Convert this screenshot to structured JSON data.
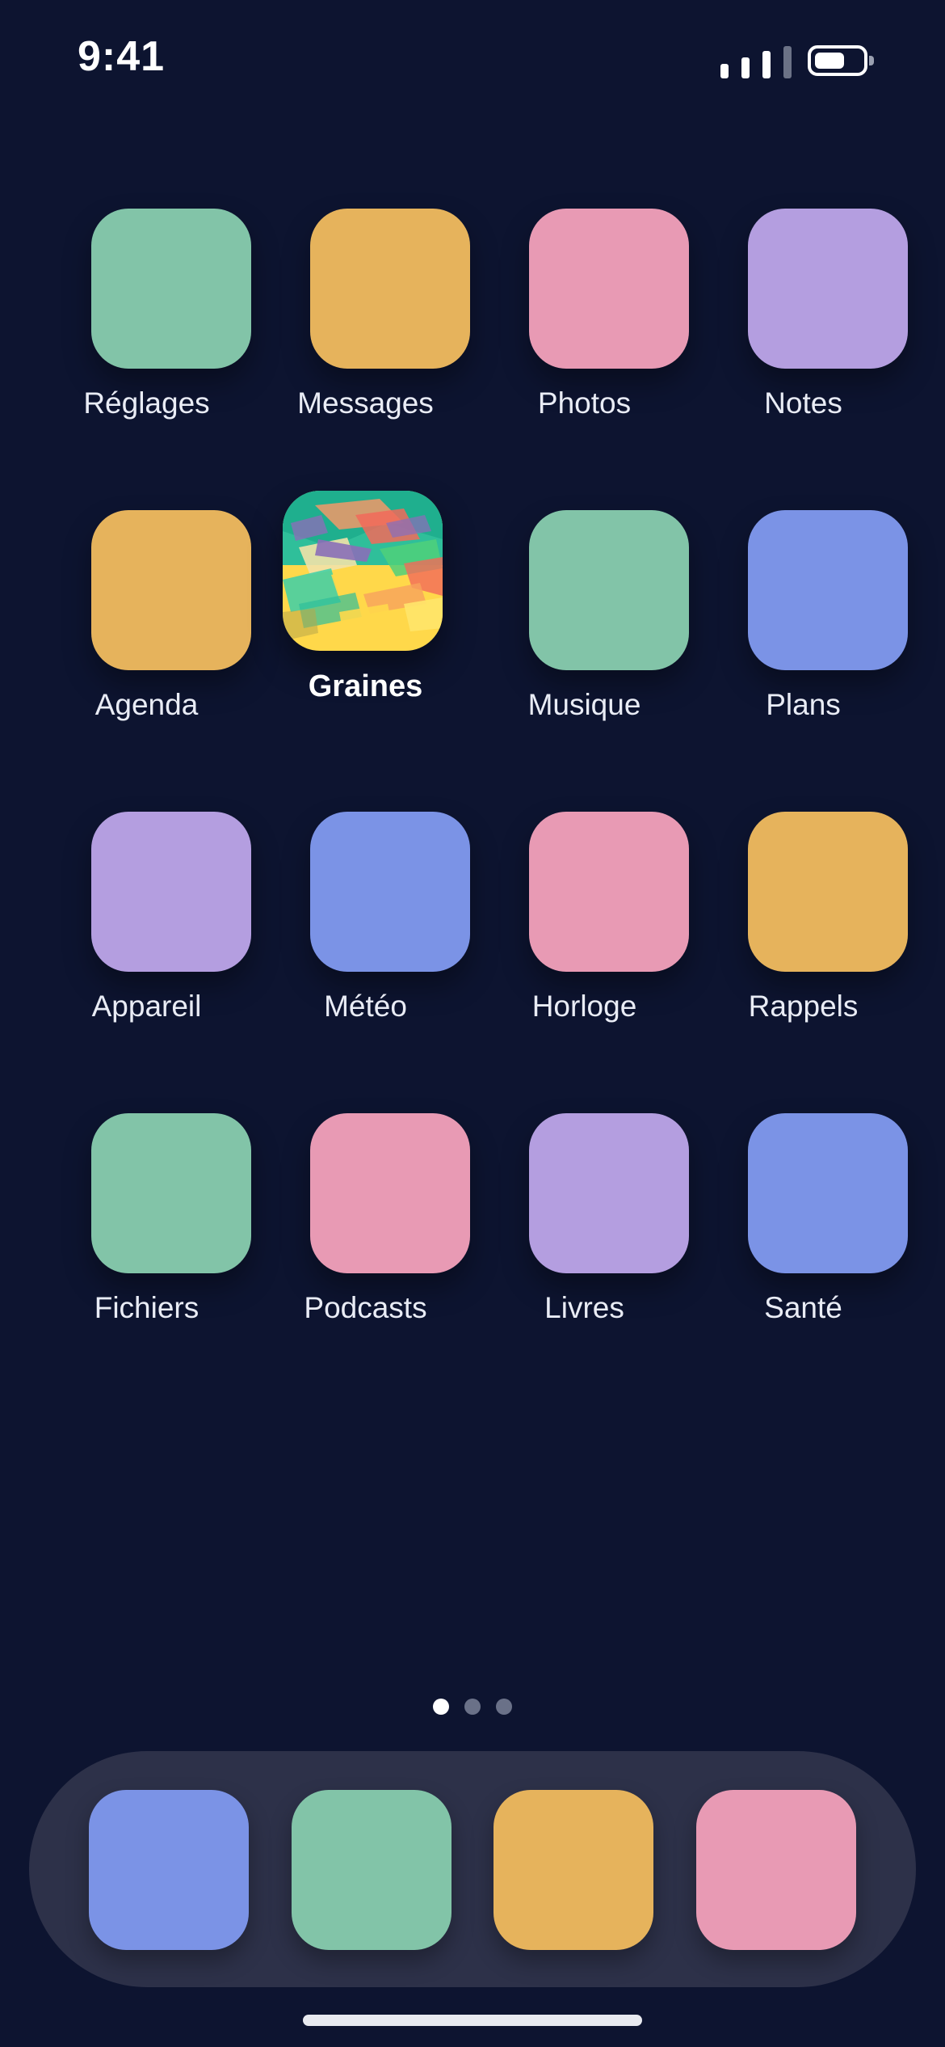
{
  "status_bar": {
    "time": "9:41",
    "signal_icon": "cellular-signal-icon",
    "battery_icon": "battery-icon",
    "battery_level": 0.7
  },
  "apps": [
    {
      "label": "Réglages",
      "color": "#82c4a8"
    },
    {
      "label": "Messages",
      "color": "#e6b35c"
    },
    {
      "label": "Photos",
      "color": "#e89ab4"
    },
    {
      "label": "Notes",
      "color": "#b49ee0"
    },
    {
      "label": "Agenda",
      "color": "#e6b35c"
    },
    {
      "label": "Graines",
      "color": "#ffd84a",
      "highlighted": true
    },
    {
      "label": "Musique",
      "color": "#82c4a8"
    },
    {
      "label": "Plans",
      "color": "#7b93e6"
    },
    {
      "label": "Appareil",
      "color": "#b49ee0"
    },
    {
      "label": "Météo",
      "color": "#7b93e6"
    },
    {
      "label": "Horloge",
      "color": "#e89ab4"
    },
    {
      "label": "Rappels",
      "color": "#e6b35c"
    },
    {
      "label": "Fichiers",
      "color": "#82c4a8"
    },
    {
      "label": "Podcasts",
      "color": "#e89ab4"
    },
    {
      "label": "Livres",
      "color": "#b49ee0"
    },
    {
      "label": "Santé",
      "color": "#7b93e6"
    }
  ],
  "page_indicator": {
    "pages": 3,
    "current": 1
  },
  "dock": {
    "icons": [
      {
        "color": "#7b93e6"
      },
      {
        "color": "#82c4a8"
      },
      {
        "color": "#e6b35c"
      },
      {
        "color": "#e89ab4"
      }
    ]
  },
  "colors": {
    "background": "#0d1430",
    "dock_background": "#2d3149"
  }
}
